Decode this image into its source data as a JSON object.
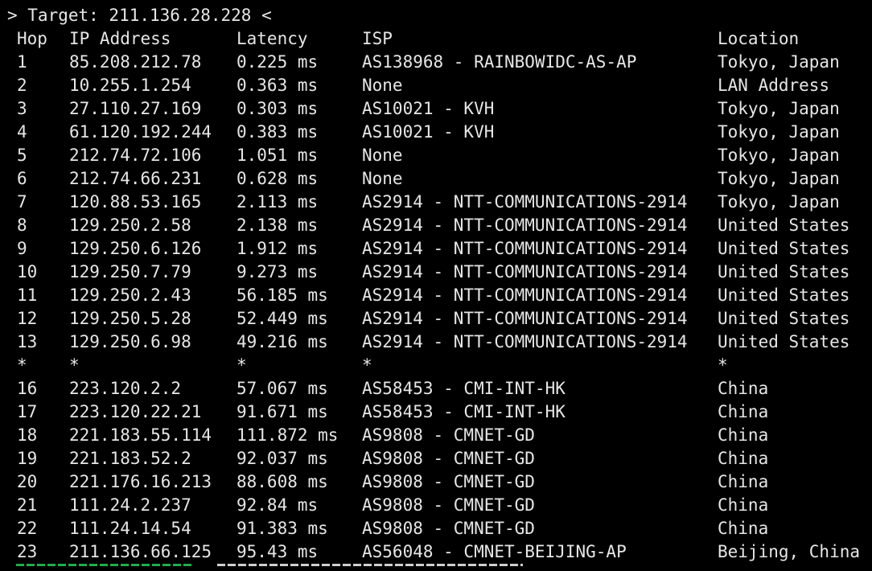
{
  "terminal": {
    "target_line": "> Target: 211.136.28.228 <"
  },
  "table": {
    "headers": {
      "hop": "Hop",
      "ip": "IP Address",
      "latency": "Latency",
      "isp": "ISP",
      "location": "Location"
    },
    "rows": [
      {
        "hop": "1",
        "ip": "85.208.212.78",
        "latency": "0.225 ms",
        "isp": "AS138968 - RAINBOWIDC-AS-AP",
        "location": "Tokyo, Japan"
      },
      {
        "hop": "2",
        "ip": "10.255.1.254",
        "latency": "0.363 ms",
        "isp": "None",
        "location": "LAN Address"
      },
      {
        "hop": "3",
        "ip": "27.110.27.169",
        "latency": "0.303 ms",
        "isp": "AS10021 - KVH",
        "location": "Tokyo, Japan"
      },
      {
        "hop": "4",
        "ip": "61.120.192.244",
        "latency": "0.383 ms",
        "isp": "AS10021 - KVH",
        "location": "Tokyo, Japan"
      },
      {
        "hop": "5",
        "ip": "212.74.72.106",
        "latency": "1.051 ms",
        "isp": "None",
        "location": "Tokyo, Japan"
      },
      {
        "hop": "6",
        "ip": "212.74.66.231",
        "latency": "0.628 ms",
        "isp": "None",
        "location": "Tokyo, Japan"
      },
      {
        "hop": "7",
        "ip": "120.88.53.165",
        "latency": "2.113 ms",
        "isp": "AS2914 - NTT-COMMUNICATIONS-2914",
        "location": "Tokyo, Japan"
      },
      {
        "hop": "8",
        "ip": "129.250.2.58",
        "latency": "2.138 ms",
        "isp": "AS2914 - NTT-COMMUNICATIONS-2914",
        "location": "United States"
      },
      {
        "hop": "9",
        "ip": "129.250.6.126",
        "latency": "1.912 ms",
        "isp": "AS2914 - NTT-COMMUNICATIONS-2914",
        "location": "United States"
      },
      {
        "hop": "10",
        "ip": "129.250.7.79",
        "latency": "9.273 ms",
        "isp": "AS2914 - NTT-COMMUNICATIONS-2914",
        "location": "United States"
      },
      {
        "hop": "11",
        "ip": "129.250.2.43",
        "latency": "56.185 ms",
        "isp": "AS2914 - NTT-COMMUNICATIONS-2914",
        "location": "United States"
      },
      {
        "hop": "12",
        "ip": "129.250.5.28",
        "latency": "52.449 ms",
        "isp": "AS2914 - NTT-COMMUNICATIONS-2914",
        "location": "United States"
      },
      {
        "hop": "13",
        "ip": "129.250.6.98",
        "latency": "49.216 ms",
        "isp": "AS2914 - NTT-COMMUNICATIONS-2914",
        "location": "United States"
      },
      {
        "hop": "*",
        "ip": "*",
        "latency": "*",
        "isp": "*",
        "location": "*"
      },
      {
        "hop": "16",
        "ip": "223.120.2.2",
        "latency": "57.067 ms",
        "isp": "AS58453 - CMI-INT-HK",
        "location": "China"
      },
      {
        "hop": "17",
        "ip": "223.120.22.21",
        "latency": "91.671 ms",
        "isp": "AS58453 - CMI-INT-HK",
        "location": "China"
      },
      {
        "hop": "18",
        "ip": "221.183.55.114",
        "latency": "111.872 ms",
        "isp": "AS9808 - CMNET-GD",
        "location": "China"
      },
      {
        "hop": "19",
        "ip": "221.183.52.2",
        "latency": "92.037 ms",
        "isp": "AS9808 - CMNET-GD",
        "location": "China"
      },
      {
        "hop": "20",
        "ip": "221.176.16.213",
        "latency": "88.608 ms",
        "isp": "AS9808 - CMNET-GD",
        "location": "China"
      },
      {
        "hop": "21",
        "ip": "111.24.2.237",
        "latency": "92.84 ms",
        "isp": "AS9808 - CMNET-GD",
        "location": "China"
      },
      {
        "hop": "22",
        "ip": "111.24.14.54",
        "latency": "91.383 ms",
        "isp": "AS9808 - CMNET-GD",
        "location": "China"
      },
      {
        "hop": "23",
        "ip": "211.136.66.125",
        "latency": "95.43 ms",
        "isp": "AS56048 - CMNET-BEIJING-AP",
        "location": "Beijing, China"
      }
    ]
  },
  "colors": {
    "background": "#000000",
    "text": "#e6e6e6",
    "prompt_green": "#1fae4a"
  }
}
